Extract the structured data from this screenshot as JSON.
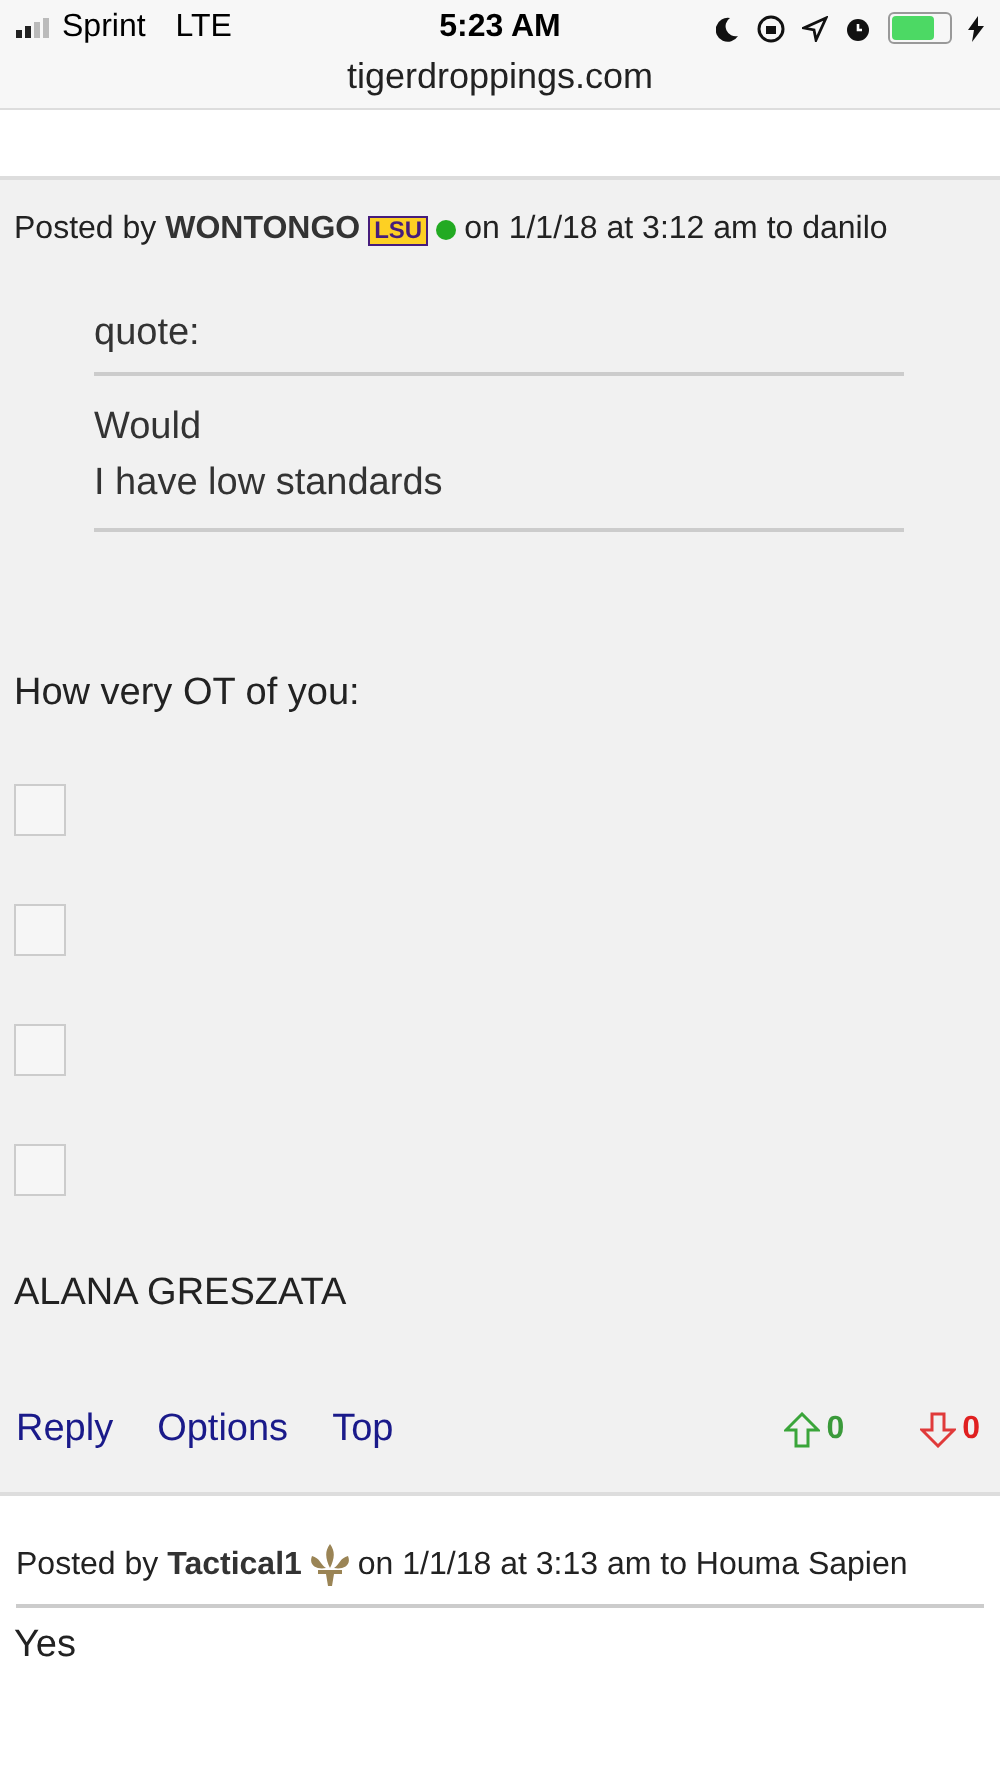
{
  "status_bar": {
    "carrier": "Sprint",
    "network": "LTE",
    "time": "5:23 AM"
  },
  "url_bar": {
    "url": "tigerdroppings.com"
  },
  "posts": [
    {
      "by_label": "Posted by",
      "author": "WONTONGO",
      "badge": {
        "kind": "team",
        "text": "LSU"
      },
      "online": true,
      "meta": "on 1/1/18 at 3:12 am to danilo",
      "quote": {
        "label": "quote:",
        "lines": [
          "Would",
          "I have low standards"
        ]
      },
      "body": [
        {
          "kind": "text",
          "text": "How very OT of you:"
        },
        {
          "kind": "checkbox",
          "checked": false
        },
        {
          "kind": "checkbox",
          "checked": false
        },
        {
          "kind": "checkbox",
          "checked": false
        },
        {
          "kind": "checkbox",
          "checked": false
        },
        {
          "kind": "text",
          "text": "ALANA GRESZATA"
        }
      ],
      "actions": [
        "Reply",
        "Options",
        "Top"
      ],
      "upvotes": "0",
      "downvotes": "0"
    },
    {
      "by_label": "Posted by",
      "author": "Tactical1",
      "badge": {
        "kind": "fleur"
      },
      "meta": "on 1/1/18 at 3:13 am to Houma Sapien",
      "body": [
        {
          "kind": "text",
          "text": "Yes"
        }
      ]
    }
  ]
}
